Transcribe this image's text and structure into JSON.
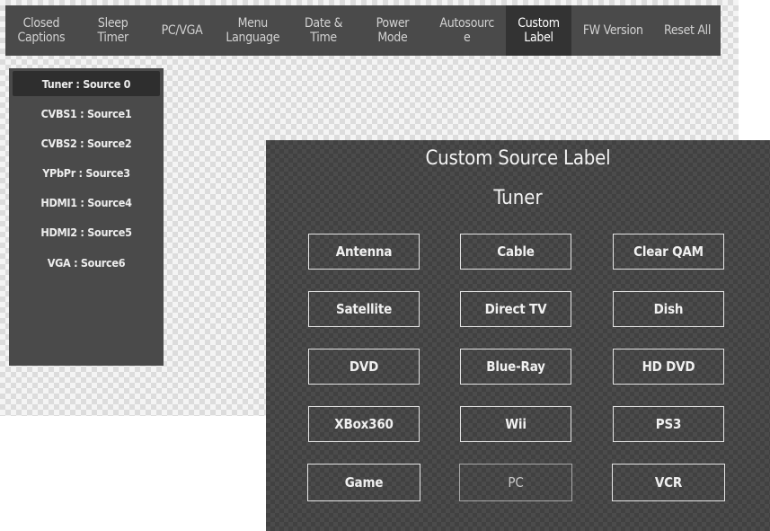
{
  "menu": {
    "tabs": [
      {
        "label": "Closed\nCaptions"
      },
      {
        "label": "Sleep\nTimer"
      },
      {
        "label": "PC/VGA"
      },
      {
        "label": "Menu\nLanguage"
      },
      {
        "label": "Date &\nTime"
      },
      {
        "label": "Power\nMode"
      },
      {
        "label": "Autosourc\ne"
      },
      {
        "label": "Custom\nLabel"
      },
      {
        "label": "FW Version"
      },
      {
        "label": "Reset All"
      }
    ],
    "active_tab": "Custom Label"
  },
  "sources": [
    {
      "label": "Tuner : Source 0",
      "selected": true
    },
    {
      "label": "CVBS1 : Source1"
    },
    {
      "label": "CVBS2 : Source2"
    },
    {
      "label": "YPbPr : Source3"
    },
    {
      "label": "HDMI1 : Source4"
    },
    {
      "label": "HDMI2 : Source5"
    },
    {
      "label": "VGA : Source6"
    }
  ],
  "dialog": {
    "title": "Custom Source Label",
    "subtitle": "Tuner",
    "options": [
      {
        "label": "Antenna"
      },
      {
        "label": "Cable"
      },
      {
        "label": "Clear QAM"
      },
      {
        "label": "Satellite"
      },
      {
        "label": "Direct TV"
      },
      {
        "label": "Dish"
      },
      {
        "label": "DVD"
      },
      {
        "label": "Blue-Ray"
      },
      {
        "label": "HD DVD"
      },
      {
        "label": "XBox360"
      },
      {
        "label": "Wii"
      },
      {
        "label": "PS3"
      },
      {
        "label": "Game"
      },
      {
        "label": "PC",
        "highlighted": true
      },
      {
        "label": "VCR"
      }
    ]
  }
}
